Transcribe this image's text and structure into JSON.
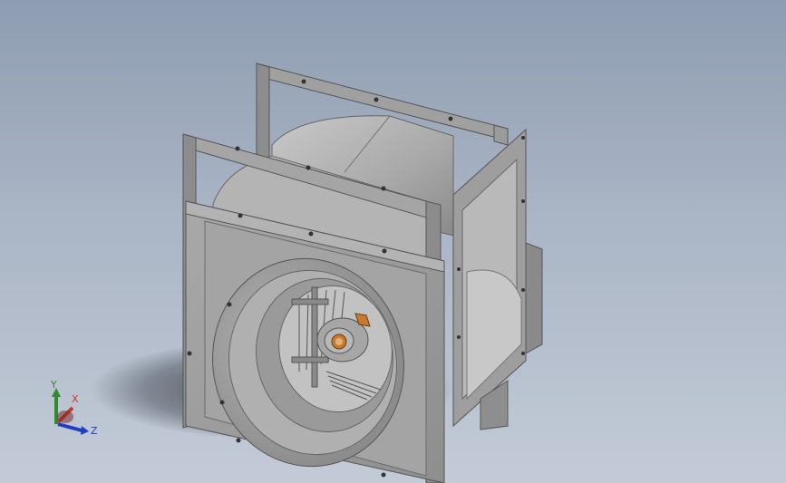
{
  "viewport": {
    "background_top": "#8e9db1",
    "background_bottom": "#c3cbd7",
    "model_color": "#9a9a9a"
  },
  "triad": {
    "x_label": "X",
    "y_label": "Y",
    "z_label": "Z",
    "x_color": "#c0392b",
    "y_color": "#2e8b2e",
    "z_color": "#1f3fbf"
  }
}
